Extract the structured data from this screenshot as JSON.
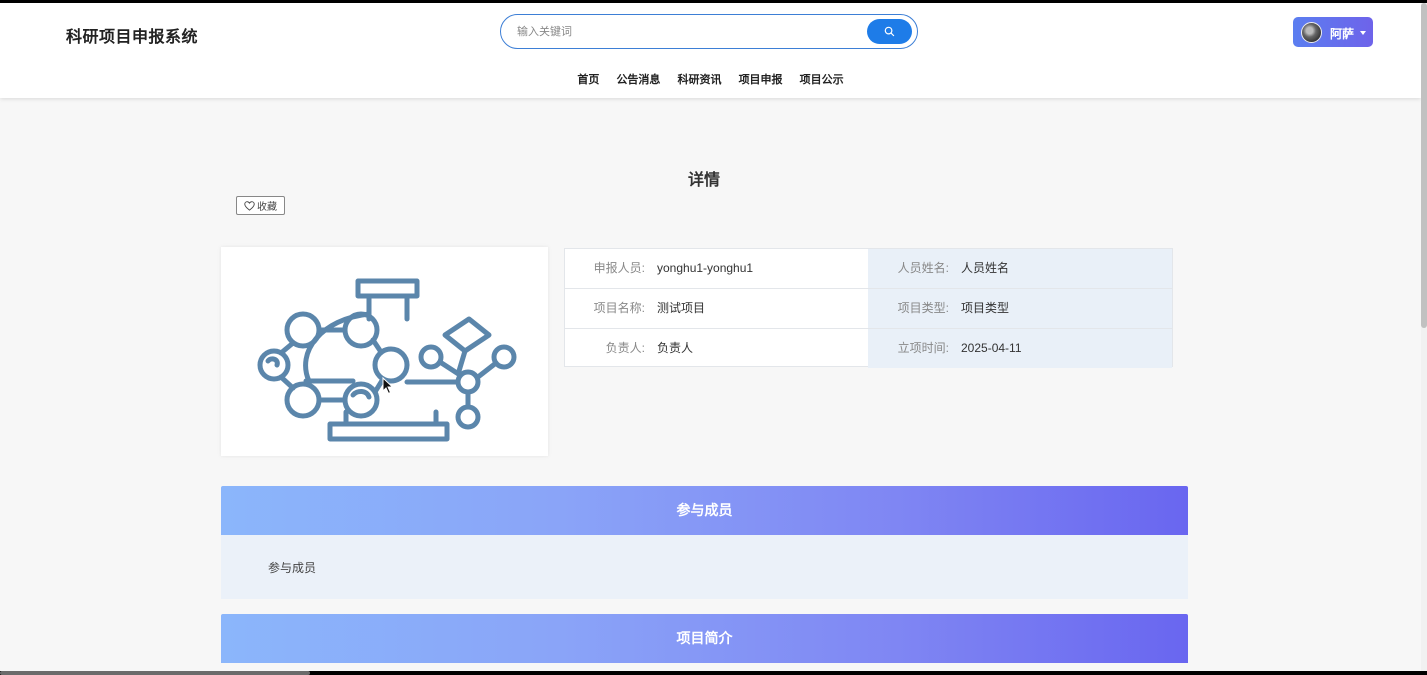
{
  "header": {
    "logo": "科研项目申报系统",
    "search_placeholder": "输入关键词",
    "user_name": "阿萨"
  },
  "nav": {
    "items": [
      "首页",
      "公告消息",
      "科研资讯",
      "项目申报",
      "项目公示"
    ]
  },
  "detail": {
    "title": "详情",
    "favorite_label": "收藏",
    "fields": [
      {
        "label": "申报人员:",
        "value": "yonghu1-yonghu1"
      },
      {
        "label": "人员姓名:",
        "value": "人员姓名"
      },
      {
        "label": "项目名称:",
        "value": "测试项目"
      },
      {
        "label": "项目类型:",
        "value": "项目类型"
      },
      {
        "label": "负责人:",
        "value": "负责人"
      },
      {
        "label": "立项时间:",
        "value": "2025-04-11"
      }
    ]
  },
  "sections": [
    {
      "title": "参与成员",
      "content": "参与成员"
    },
    {
      "title": "项目简介"
    }
  ],
  "icons": {
    "search": "search-icon",
    "favorite": "heart-icon",
    "project_image": "lab-flask-molecule-icon"
  },
  "colors": {
    "primary": "#1e7ce8",
    "icon_stroke": "#5b86ab",
    "gradient_start": "#8bb6fb",
    "gradient_end": "#6966f0"
  }
}
